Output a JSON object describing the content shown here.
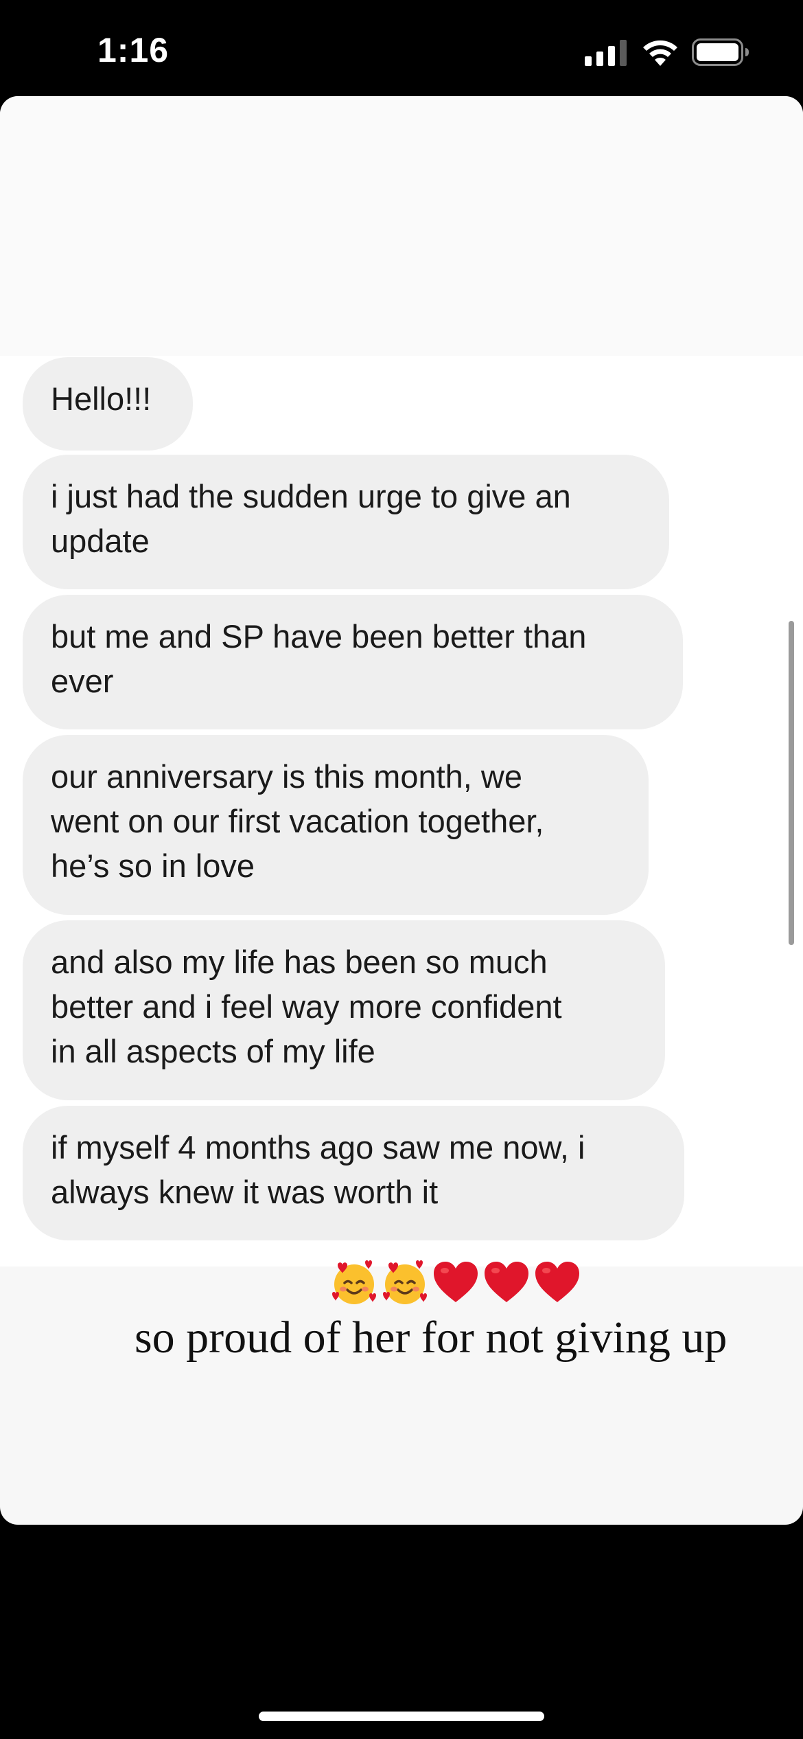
{
  "status_bar": {
    "time": "1:16",
    "signal_icon": "cellular-signal-icon",
    "wifi_icon": "wifi-icon",
    "battery_icon": "battery-icon"
  },
  "messages": [
    {
      "text": "Hello!!!"
    },
    {
      "text": "i just had the sudden urge to give an\nupdate"
    },
    {
      "text": "but me and SP have been better than\never"
    },
    {
      "text": "our anniversary is this month, we\nwent on our first vacation together,\nhe’s so in love"
    },
    {
      "text": "and also my life has been so much\nbetter and i feel way more confident\nin all aspects of my life"
    },
    {
      "text": "if myself 4 months ago saw me now, i\nalways knew it was worth it"
    }
  ],
  "caption": {
    "emojis": [
      "smiling-face-with-hearts-emoji",
      "smiling-face-with-hearts-emoji",
      "red-heart-emoji",
      "red-heart-emoji",
      "red-heart-emoji"
    ],
    "text": "so proud of her for not giving up"
  },
  "colors": {
    "bubble_background": "#efefef",
    "heart_red": "#e0162b",
    "emoji_yellow": "#fbc02d"
  }
}
